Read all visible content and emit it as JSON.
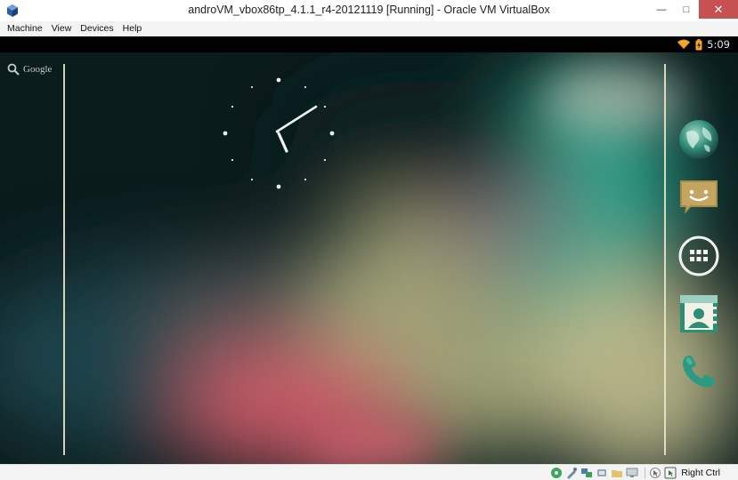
{
  "window": {
    "title": "androVM_vbox86tp_4.1.1_r4-20121119 [Running] - Oracle VM VirtualBox",
    "minimize_glyph": "—",
    "maximize_glyph": "□",
    "close_glyph": "✕"
  },
  "menu": {
    "items": [
      "Machine",
      "View",
      "Devices",
      "Help"
    ]
  },
  "android": {
    "status_time": "5:09",
    "search_label": "Google",
    "clock": {
      "hour": 5,
      "minute": 9
    },
    "dock": [
      "browser-icon",
      "messaging-icon",
      "all-apps-icon",
      "contacts-icon",
      "phone-icon"
    ]
  },
  "vbox_status": {
    "host_key_label": "Right Ctrl"
  },
  "colors": {
    "close_button": "#c75050",
    "android_bg": "#0b1c1d",
    "teal": "#2fa68e",
    "pink": "#c55a6a",
    "khaki": "#b9b98a"
  }
}
